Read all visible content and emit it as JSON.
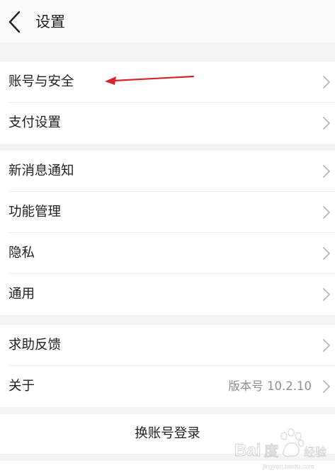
{
  "header": {
    "title": "设置",
    "back_icon": "chevron-left-icon"
  },
  "groups": [
    {
      "items": [
        {
          "label": "账号与安全"
        },
        {
          "label": "支付设置"
        }
      ]
    },
    {
      "items": [
        {
          "label": "新消息通知"
        },
        {
          "label": "功能管理"
        },
        {
          "label": "隐私"
        },
        {
          "label": "通用"
        }
      ]
    },
    {
      "items": [
        {
          "label": "求助反馈"
        },
        {
          "label": "关于",
          "value": "版本号 10.2.10"
        }
      ]
    }
  ],
  "switch_account": {
    "label": "换账号登录"
  },
  "annotation": {
    "arrow_color": "#d6262b"
  },
  "watermark": {
    "text": "Bai度 经验"
  },
  "colors": {
    "background": "#f4f3f7",
    "card": "#ffffff",
    "text": "#222222",
    "secondary_text": "#8e8e93",
    "chevron": "#b8b8bd"
  }
}
